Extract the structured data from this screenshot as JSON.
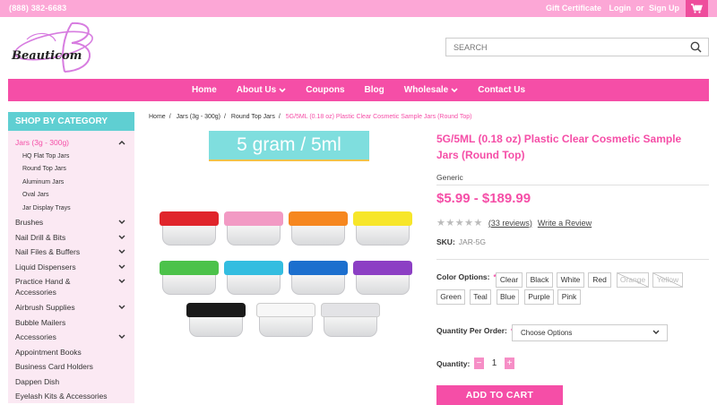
{
  "topbar": {
    "phone": "(888) 382-6683",
    "gift_certificate": "Gift Certificate",
    "login": "Login",
    "or": "or",
    "signup": "Sign Up",
    "cart_icon": "cart-icon"
  },
  "header": {
    "logo_text": "Beauticom",
    "search_placeholder": "SEARCH",
    "search_icon": "search-icon"
  },
  "nav": {
    "items": [
      {
        "label": "Home",
        "dropdown": false
      },
      {
        "label": "About Us",
        "dropdown": true
      },
      {
        "label": "Coupons",
        "dropdown": false
      },
      {
        "label": "Blog",
        "dropdown": false
      },
      {
        "label": "Wholesale",
        "dropdown": true
      },
      {
        "label": "Contact Us",
        "dropdown": false
      }
    ]
  },
  "sidebar": {
    "heading": "SHOP BY CATEGORY",
    "active_category": "Jars (3g - 300g)",
    "subcategories": [
      "HQ Flat Top Jars",
      "Round Top Jars",
      "Aluminum Jars",
      "Oval Jars",
      "Jar Display Trays"
    ],
    "categories": [
      {
        "label": "Brushes",
        "expandable": true
      },
      {
        "label": "Nail Drill & Bits",
        "expandable": true
      },
      {
        "label": "Nail Files & Buffers",
        "expandable": true
      },
      {
        "label": "Liquid Dispensers",
        "expandable": true
      },
      {
        "label": "Practice Hand & Accessories",
        "expandable": true
      },
      {
        "label": "Airbrush Supplies",
        "expandable": true
      },
      {
        "label": "Bubble Mailers",
        "expandable": false
      },
      {
        "label": "Accessories",
        "expandable": true
      },
      {
        "label": "Appointment Books",
        "expandable": false
      },
      {
        "label": "Business Card Holders",
        "expandable": false
      },
      {
        "label": "Dappen Dish",
        "expandable": false
      },
      {
        "label": "Eyelash Kits & Accessories",
        "expandable": false
      }
    ]
  },
  "breadcrumb": [
    "Home",
    "Jars (3g - 300g)",
    "Round Top Jars",
    "5G/5ML (0.18 oz) Plastic Clear Cosmetic Sample Jars (Round Top)"
  ],
  "product_image": {
    "banner": "5 gram / 5ml",
    "lid_colors": [
      "#e0252b",
      "#f29ac4",
      "#f6871f",
      "#f7e62a",
      "#4cc24a",
      "#33bde0",
      "#1c6fce",
      "#8c3fc4",
      "#1a1a1a",
      "#f7f7f7",
      "#e3e3e6"
    ]
  },
  "product": {
    "title": "5G/5ML (0.18 oz) Plastic Clear Cosmetic Sample Jars (Round Top)",
    "brand": "Generic",
    "price": "$5.99 - $189.99",
    "stars": "★★★★★",
    "reviews": "(33 reviews)",
    "write_review": "Write a Review",
    "sku_label": "SKU:",
    "sku": "JAR-5G",
    "color_label": "Color Options:",
    "required_mark": "*",
    "colors": [
      {
        "label": "Clear",
        "disabled": false
      },
      {
        "label": "Black",
        "disabled": false
      },
      {
        "label": "White",
        "disabled": false
      },
      {
        "label": "Red",
        "disabled": false
      },
      {
        "label": "Orange",
        "disabled": true
      },
      {
        "label": "Yellow",
        "disabled": true
      },
      {
        "label": "Green",
        "disabled": false
      },
      {
        "label": "Teal",
        "disabled": false
      },
      {
        "label": "Blue",
        "disabled": false
      },
      {
        "label": "Purple",
        "disabled": false
      },
      {
        "label": "Pink",
        "disabled": false
      }
    ],
    "quantity_per_order_label": "Quantity Per Order:",
    "quantity_per_order_value": "Choose Options",
    "quantity_label": "Quantity:",
    "quantity": "1",
    "minus": "−",
    "plus": "+",
    "add_to_cart": "ADD TO CART"
  }
}
